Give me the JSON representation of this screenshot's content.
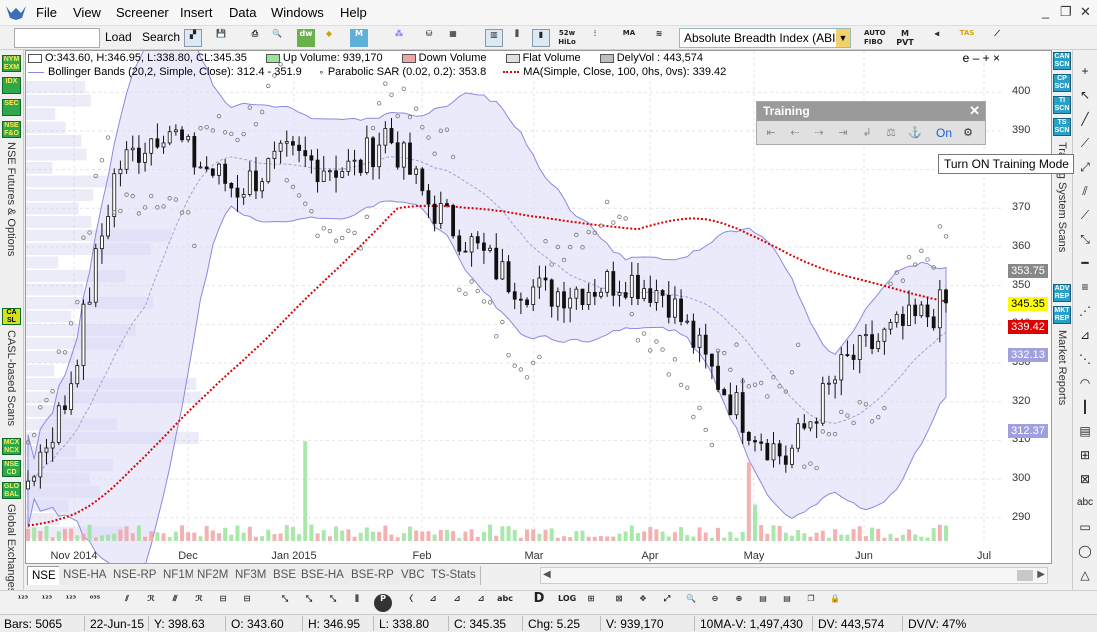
{
  "menu": {
    "items": [
      "File",
      "View",
      "Screener",
      "Insert",
      "Data",
      "Windows",
      "Help"
    ]
  },
  "toolbar": {
    "load_label": "Load",
    "search_label": "Search",
    "indicator_select": "Absolute Breadth Index (ABI",
    "icons_left": [
      "dw",
      "52w HiLo",
      "MA"
    ],
    "icons_right": [
      "AUTO FIBO",
      "M PVT",
      "TAS"
    ]
  },
  "left_sidebar": {
    "buttons": [
      {
        "label": "NYM EXM"
      },
      {
        "label": "IDX"
      },
      {
        "label": "SEC"
      },
      {
        "label": "NSE F&O"
      },
      {
        "label": "CA SL"
      },
      {
        "label": "MCX NCX"
      },
      {
        "label": "NSE CD"
      },
      {
        "label": "GLO BAL"
      }
    ],
    "vertical_labels": [
      "NSE Futures & Options",
      "CASL-based Scans",
      "Global Exchanges"
    ]
  },
  "right_sidebar": {
    "buttons": [
      {
        "label": "CAN SCN"
      },
      {
        "label": "CP SCN"
      },
      {
        "label": "TI SCN"
      },
      {
        "label": "TS SCN"
      },
      {
        "label": "ADV REP"
      },
      {
        "label": "MKT REP"
      }
    ],
    "vertical_labels": [
      "Trading System Scans",
      "Market Reports"
    ]
  },
  "chart": {
    "ohlc_line": "O:343.60, H:346.95, L:338.80, CL:345.35",
    "volume_items": [
      {
        "label": "Up Volume: 939,170",
        "color": "#9be39b"
      },
      {
        "label": "Down Volume",
        "color": "#f2a3a3"
      },
      {
        "label": "Flat Volume",
        "color": "#e0e0e0"
      },
      {
        "label": "DelyVol : 443,574",
        "color": "#bdbdbd"
      }
    ],
    "bollinger_label": "Bollinger Bands (20,2, Simple, Close): 312.4 - 351.9",
    "sar_label": "Parabolic SAR (0.02, 0.2): 353.8",
    "ma_label": "MA(Simple, Close, 100, 0hs, 0vs): 339.42",
    "corner_controls": "e – + ×"
  },
  "chart_data": {
    "type": "candlestick",
    "y_ticks": [
      290,
      300,
      310,
      320,
      330,
      340,
      350,
      360,
      370,
      380,
      390,
      400
    ],
    "y_badges": [
      {
        "value": "353.75",
        "bg": "#888888",
        "color": "#ffffff"
      },
      {
        "value": "345.35",
        "bg": "#ffff00",
        "color": "#000000"
      },
      {
        "value": "339.42",
        "bg": "#dd0000",
        "color": "#ffffff"
      },
      {
        "value": "332.13",
        "bg": "#a0a0e0",
        "color": "#ffffff"
      },
      {
        "value": "312.37",
        "bg": "#a0a0e0",
        "color": "#ffffff"
      }
    ],
    "x_labels": [
      "Nov 2014",
      "Dec",
      "Jan 2015",
      "Feb",
      "Mar",
      "Apr",
      "May",
      "Jun",
      "Jul"
    ],
    "ylim": [
      284,
      406
    ]
  },
  "training": {
    "title": "Training",
    "on_label": "On",
    "tooltip": "Turn ON Training Mode"
  },
  "tabs": [
    "NSE",
    "NSE-HA",
    "NSE-RP",
    "NF1M",
    "NF2M",
    "NF3M",
    "BSE",
    "BSE-HA",
    "BSE-RP",
    "VBC",
    "TS-Stats"
  ],
  "status": {
    "bars": "Bars: 5065",
    "date": "22-Jun-15",
    "y": "Y: 398.63",
    "o": "O: 343.60",
    "h": "H: 346.95",
    "l": "L: 338.80",
    "c": "C: 345.35",
    "chg": "Chg: 5.25",
    "v": "V: 939,170",
    "ma_v": "10MA-V: 1,497,430",
    "dv": "DV: 443,574",
    "dvv": "DV/V: 47%"
  }
}
